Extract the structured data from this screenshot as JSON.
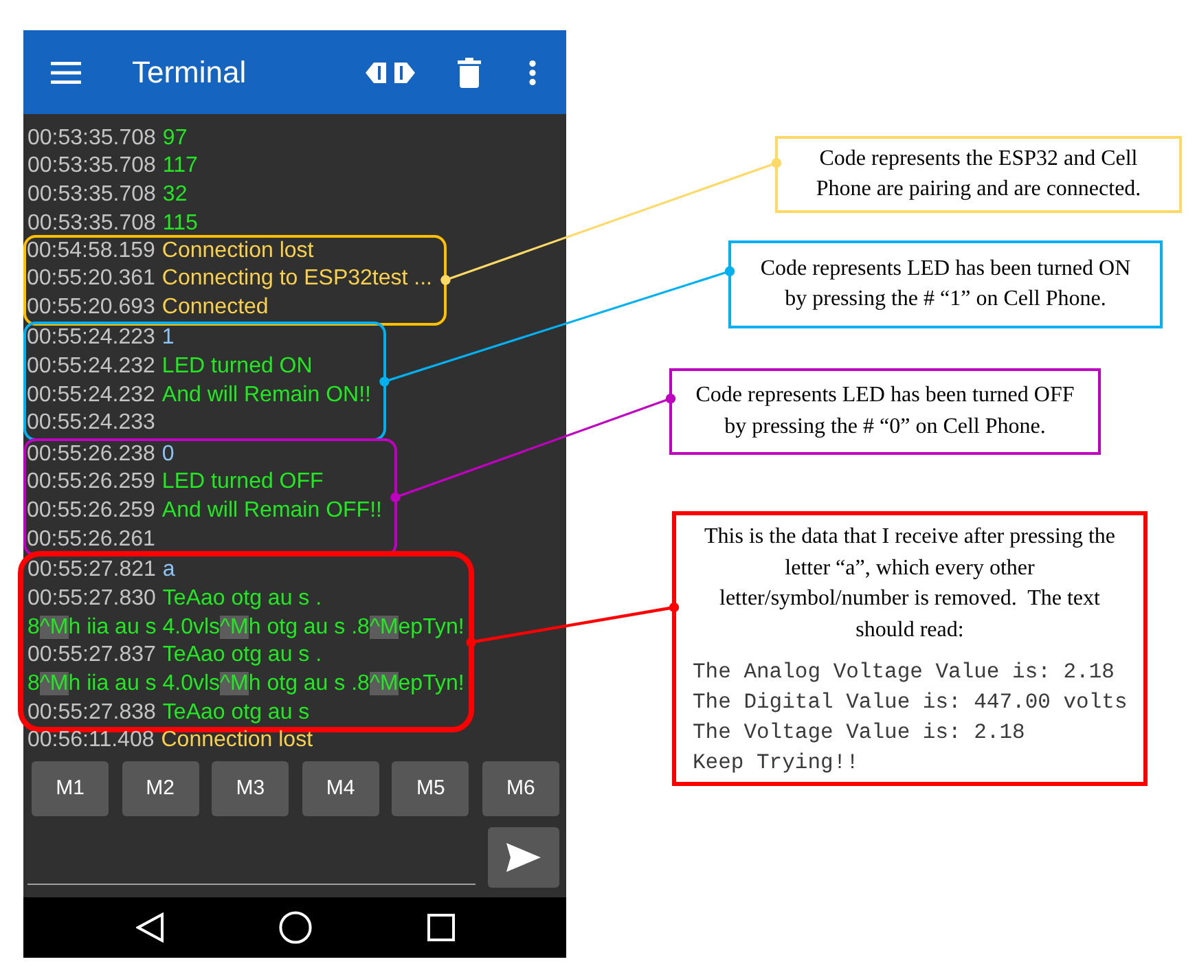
{
  "app_bar": {
    "title": "Terminal"
  },
  "terminal": {
    "blocks": [
      {
        "lines": [
          {
            "time": "00:53:35.708",
            "kind": "received",
            "text": "97"
          },
          {
            "time": "00:53:35.708",
            "kind": "received",
            "text": "117"
          },
          {
            "time": "00:53:35.708",
            "kind": "received",
            "text": "32"
          },
          {
            "time": "00:53:35.708",
            "kind": "received",
            "text": "115"
          }
        ]
      },
      {
        "frame": {
          "color": "#ffc000",
          "thick": false
        },
        "lines": [
          {
            "time": "00:54:58.159",
            "kind": "status",
            "text": "Connection lost"
          },
          {
            "time": "00:55:20.361",
            "kind": "status",
            "text": "Connecting to ESP32test ..."
          },
          {
            "time": "00:55:20.693",
            "kind": "status",
            "text": "Connected"
          }
        ]
      },
      {
        "frame": {
          "color": "#00b0f0",
          "thick": false
        },
        "lines": [
          {
            "time": "00:55:24.223",
            "kind": "sent",
            "text": "1"
          },
          {
            "time": "00:55:24.232",
            "kind": "received",
            "text": "LED turned ON"
          },
          {
            "time": "00:55:24.232",
            "kind": "received",
            "text": "And will Remain ON!!"
          },
          {
            "time": "00:55:24.233"
          }
        ]
      },
      {
        "frame": {
          "color": "#c000c0",
          "thick": false
        },
        "lines": [
          {
            "time": "00:55:26.238",
            "kind": "sent",
            "text": "0"
          },
          {
            "time": "00:55:26.259",
            "kind": "received",
            "text": "LED turned OFF"
          },
          {
            "time": "00:55:26.259",
            "kind": "received",
            "text": "And will Remain OFF!!"
          },
          {
            "time": "00:55:26.261"
          }
        ]
      },
      {
        "frame": {
          "color": "#ff0000",
          "thick": true
        },
        "lines": [
          {
            "time": "00:55:27.821",
            "kind": "sent",
            "text": "a"
          },
          {
            "time": "00:55:27.830",
            "kind": "received",
            "text": "TeAao otg au s ."
          },
          {
            "kind": "received",
            "segments": [
              {
                "text": "8",
                "marked": false
              },
              {
                "text": "^M",
                "marked": true
              },
              {
                "text": "h iia au s 4.0vls",
                "marked": false
              },
              {
                "text": "^M",
                "marked": true
              },
              {
                "text": "h otg au s .8",
                "marked": false
              },
              {
                "text": "^M",
                "marked": true
              },
              {
                "text": "epTyn!",
                "marked": false
              }
            ]
          },
          {
            "time": "00:55:27.837",
            "kind": "received",
            "text": "TeAao otg au s ."
          },
          {
            "kind": "received",
            "segments": [
              {
                "text": "8",
                "marked": false
              },
              {
                "text": "^M",
                "marked": true
              },
              {
                "text": "h iia au s 4.0vls",
                "marked": false
              },
              {
                "text": "^M",
                "marked": true
              },
              {
                "text": "h otg au s .8",
                "marked": false
              },
              {
                "text": "^M",
                "marked": true
              },
              {
                "text": "epTyn!",
                "marked": false
              }
            ]
          },
          {
            "time": "00:55:27.838",
            "kind": "received",
            "text": "TeAao otg au s"
          }
        ]
      },
      {
        "lines": [
          {
            "time": "00:56:11.408",
            "kind": "status",
            "text": "Connection lost"
          }
        ]
      }
    ]
  },
  "macro_buttons": [
    "M1",
    "M2",
    "M3",
    "M4",
    "M5",
    "M6"
  ],
  "callouts": [
    {
      "color": "#ffd966",
      "text": "Code represents the ESP32 and Cell Phone are pairing and are connected."
    },
    {
      "color": "#00b0f0",
      "text": "Code represents LED has been turned ON by pressing the # “1” on Cell Phone."
    },
    {
      "color": "#c000c0",
      "text": "Code represents LED has been turned OFF by pressing the # “0” on Cell Phone."
    },
    {
      "color": "#ff0000",
      "text": "This is the data that I receive after pressing the letter “a”, which every other letter/symbol/number is removed.  The text should read:",
      "code_lines": [
        "The Analog Voltage Value is: 2.18",
        "The Digital Value is: 447.00 volts",
        "The Voltage Value is: 2.18",
        "Keep Trying!!"
      ]
    }
  ]
}
